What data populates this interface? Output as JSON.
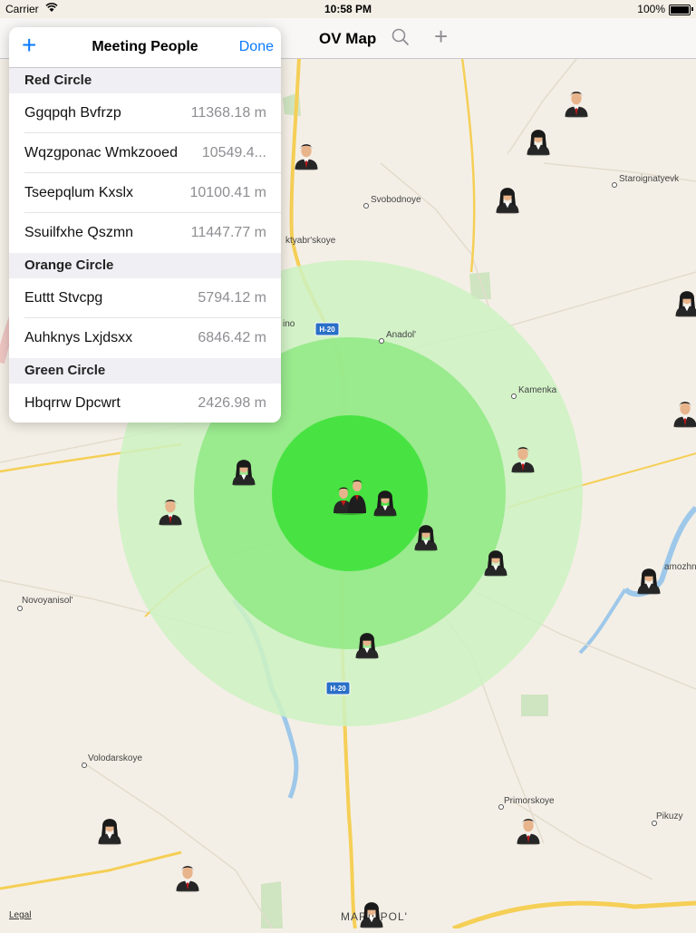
{
  "status_bar": {
    "carrier": "Carrier",
    "time": "10:58 PM",
    "battery": "100%"
  },
  "navbar": {
    "title": "OV Map",
    "search_icon": "search-icon",
    "add_icon": "plus-icon"
  },
  "popover": {
    "add_label": "+",
    "title": "Meeting People",
    "done_label": "Done",
    "sections": [
      {
        "header": "Red Circle",
        "rows": [
          {
            "name": "Ggqpqh Bvfrzp",
            "distance": "11368.18 m"
          },
          {
            "name": "Wqzgponac Wmkzooed",
            "distance": "10549.4..."
          },
          {
            "name": "Tseepqlum Kxslx",
            "distance": "10100.41 m"
          },
          {
            "name": "Ssuilfxhe Qszmn",
            "distance": "11447.77 m"
          }
        ]
      },
      {
        "header": "Orange Circle",
        "rows": [
          {
            "name": "Euttt Stvcpg",
            "distance": "5794.12 m"
          },
          {
            "name": "Auhknys Lxjdsxx",
            "distance": "6846.42 m"
          }
        ]
      },
      {
        "header": "Green Circle",
        "rows": [
          {
            "name": "Hbqrrw Dpcwrt",
            "distance": "2426.98 m"
          }
        ]
      }
    ]
  },
  "map": {
    "labels": {
      "svobodnoye": "Svobodnoye",
      "staroignatyevka": "Staroignatyevk",
      "oktyabrskoye": "ktyabr'skoye",
      "anadol": "Anadol'",
      "kamenka": "Kamenka",
      "ino": "ino",
      "novoyanisol": "Novoyanisol'",
      "volodarskoye": "Volodarskoye",
      "primorskoye": "Primorskoye",
      "pikuzy": "Pikuzy",
      "samozhn": "amozhn",
      "mariupol": "MARIUPOL'",
      "road_h20_a": "H-20",
      "road_h20_b": "H-20"
    },
    "legal": "Legal",
    "colors": {
      "outer_circle": "#cdf2c2",
      "middle_circle": "#93e987",
      "inner_circle": "#3fe23a",
      "road": "#f5cf56"
    }
  }
}
